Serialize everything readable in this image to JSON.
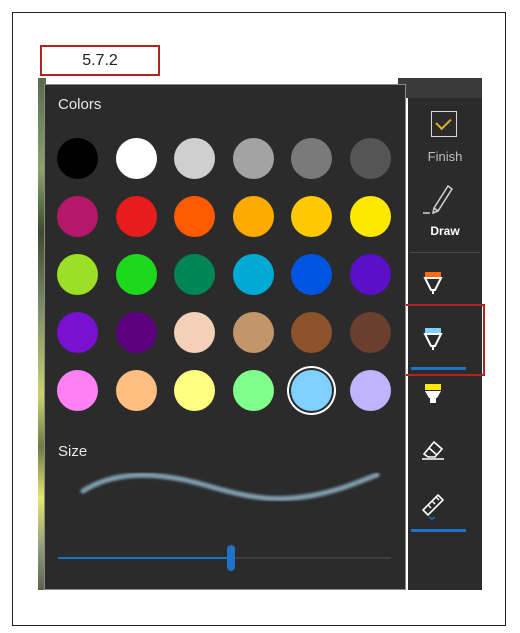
{
  "step_label": "5.7.2",
  "popup": {
    "colors_title": "Colors",
    "size_title": "Size",
    "size_value": 0.52,
    "swatches": [
      [
        "#000000",
        "#ffffff",
        "#cfcfcf",
        "#a3a3a3",
        "#7a7a7a",
        "#555555"
      ],
      [
        "#b5176b",
        "#e81c1c",
        "#ff5a00",
        "#ffaa00",
        "#ffc800",
        "#ffe800"
      ],
      [
        "#9be024",
        "#1ed81e",
        "#008556",
        "#00aad4",
        "#0055e0",
        "#5a0fc8"
      ],
      [
        "#7a10d0",
        "#5c007e",
        "#f5d0b8",
        "#c2956b",
        "#8b522c",
        "#6b3f2d"
      ],
      [
        "#ff80f4",
        "#ffbf80",
        "#ffff80",
        "#80ff8c",
        "#80d0ff",
        "#c0b4ff"
      ]
    ],
    "selected_swatch": "4-4"
  },
  "toolbar": {
    "finish_label": "Finish",
    "draw_label": "Draw",
    "tools": [
      {
        "name": "ballpoint-pen-icon",
        "tip_color": "#ff6a13"
      },
      {
        "name": "pencil-icon",
        "tip_color": "#80d0ff"
      },
      {
        "name": "highlighter-icon",
        "tip_color": "#ffe800"
      },
      {
        "name": "eraser-icon"
      },
      {
        "name": "ruler-icon"
      }
    ]
  },
  "colors": {
    "panel_bg": "#2b2b2b",
    "accent": "#1e73c8",
    "annotation_red": "#b22222"
  }
}
